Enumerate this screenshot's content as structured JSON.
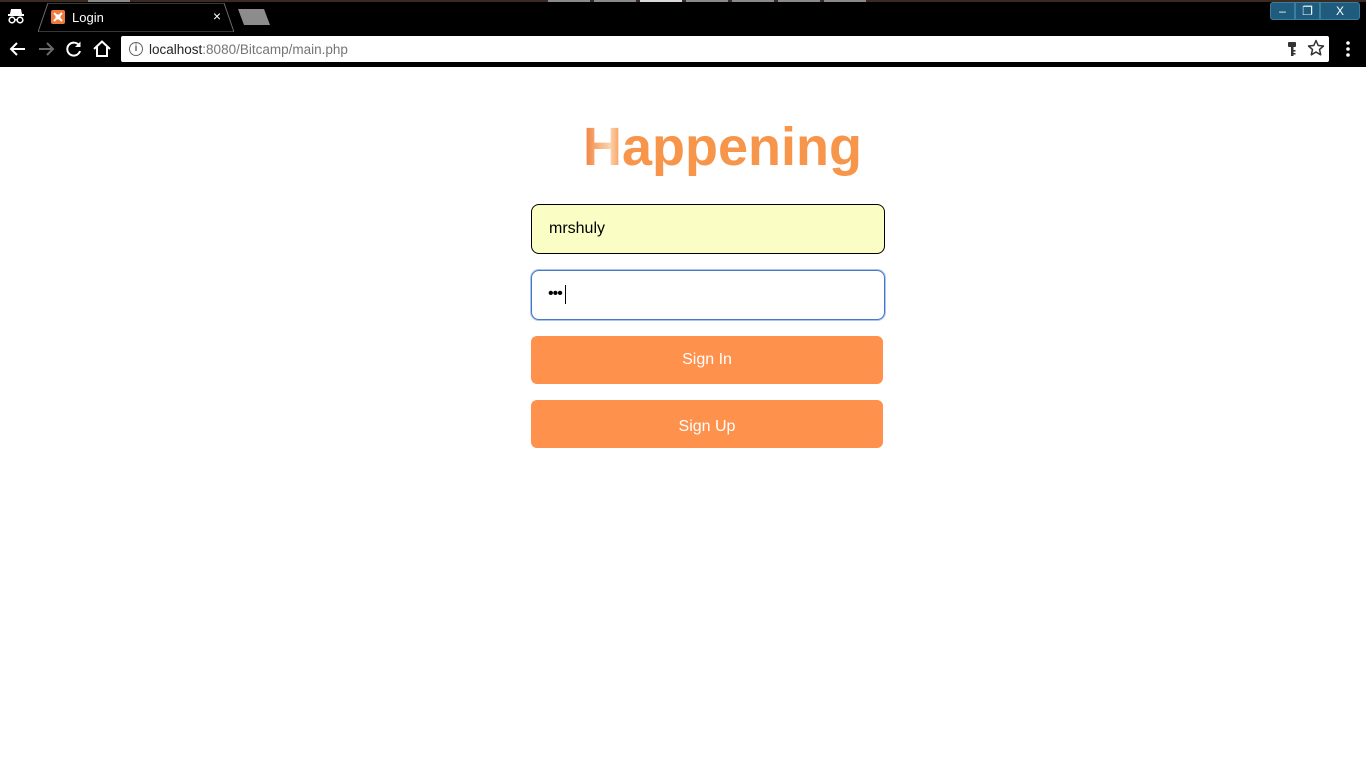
{
  "browser": {
    "tab": {
      "title": "Login",
      "close_glyph": "×",
      "favicon": "xampp-icon"
    },
    "window_controls": {
      "minimize": "–",
      "maximize": "❐",
      "close": "X"
    },
    "address_bar": {
      "host": "localhost",
      "path": ":8080/Bitcamp/main.php"
    },
    "icons": {
      "incognito": "incognito-icon",
      "back": "back-arrow-icon",
      "forward": "forward-arrow-icon",
      "reload": "reload-icon",
      "home": "home-icon",
      "info": "info-icon",
      "key": "key-icon",
      "star": "star-icon",
      "menu": "kebab-menu-icon"
    }
  },
  "login": {
    "logo_first": "H",
    "logo_rest": "appening",
    "username_value": "mrshuly",
    "password_mask": "•••",
    "signin_label": "Sign In",
    "signup_label": "Sign Up"
  },
  "colors": {
    "accent": "#fe914c",
    "logo": "#f7954b",
    "autofill_bg": "#fafec4",
    "focus_border": "#4a78c8"
  }
}
